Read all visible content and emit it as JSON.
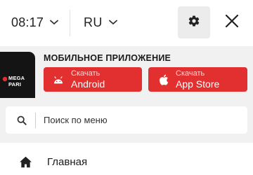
{
  "header": {
    "time_format": "08:17",
    "language": "RU"
  },
  "promo": {
    "title": "МОБИЛЬНОЕ ПРИЛОЖЕНИЕ",
    "logo_text": "MEGA PARI",
    "android": {
      "prefix": "Скачать",
      "name": "Android"
    },
    "apple": {
      "prefix": "Скачать",
      "name": "App Store"
    }
  },
  "search": {
    "placeholder": "Поиск по меню",
    "value": ""
  },
  "menu": {
    "items": [
      {
        "label": "Главная",
        "icon": "home-icon"
      }
    ]
  },
  "colors": {
    "accent": "#e22f2f",
    "banner_bg": "#f1f1f1",
    "settings_bg": "#ececec"
  }
}
